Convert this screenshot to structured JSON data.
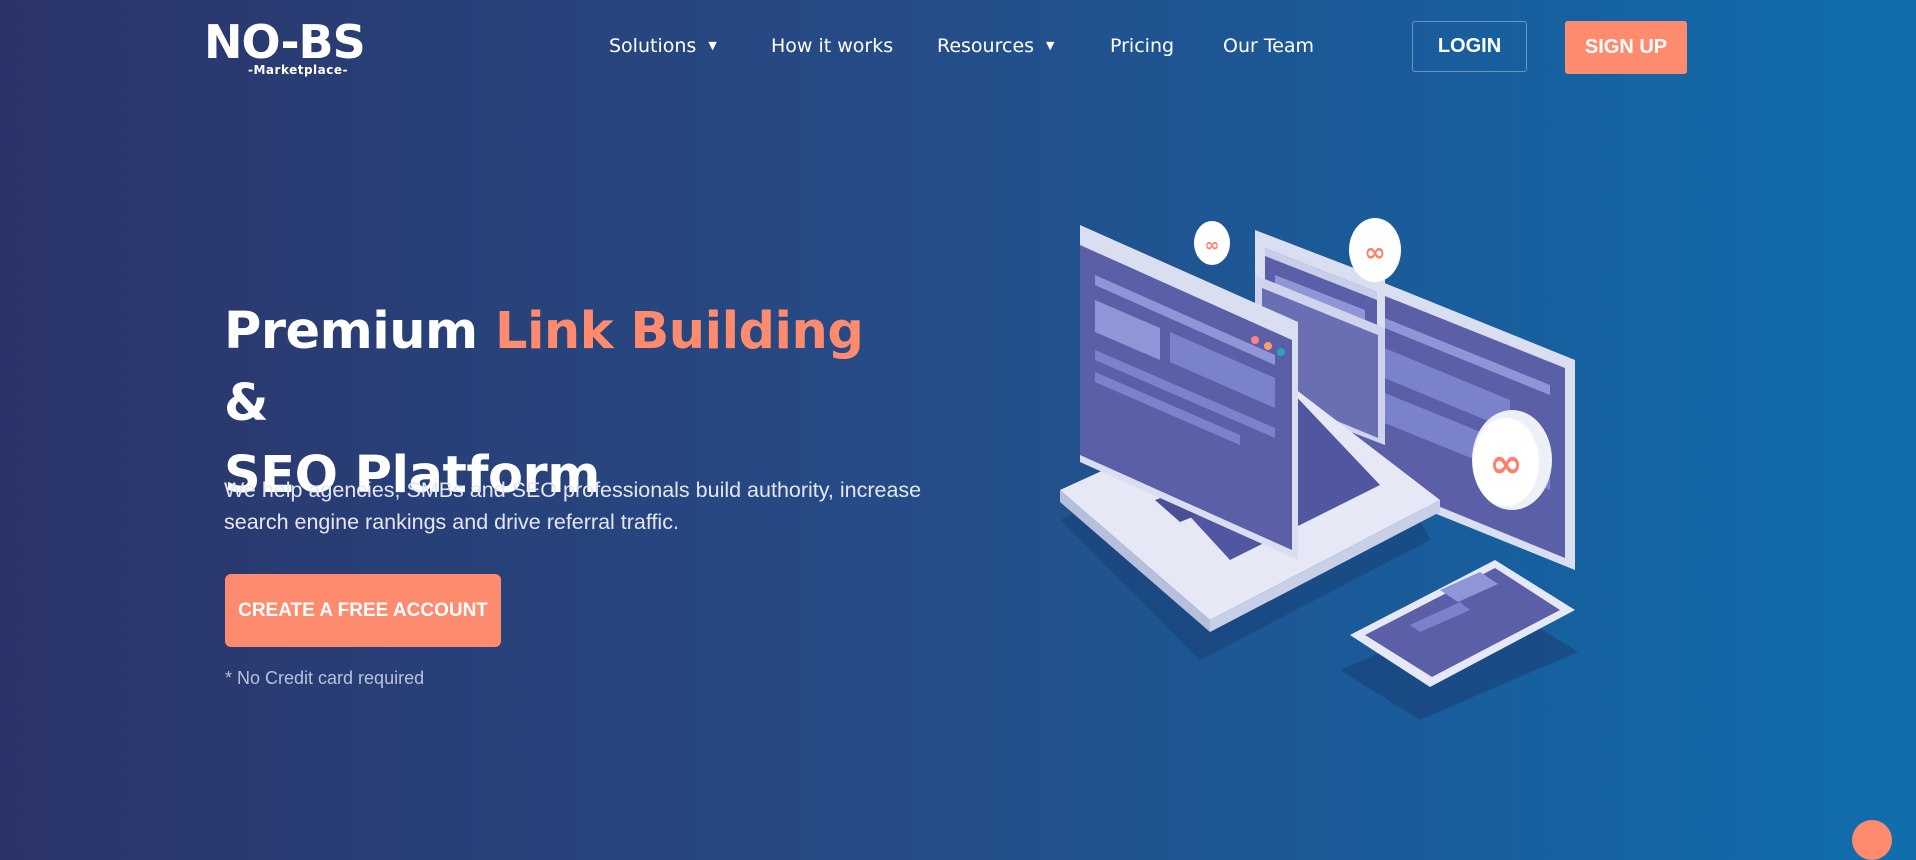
{
  "brand": {
    "logo_text": "NO-BS",
    "logo_sub": "-Marketplace-"
  },
  "nav": {
    "items": [
      {
        "label": "Solutions",
        "has_dropdown": true
      },
      {
        "label": "How it works",
        "has_dropdown": false
      },
      {
        "label": "Resources",
        "has_dropdown": true
      },
      {
        "label": "Pricing",
        "has_dropdown": false
      },
      {
        "label": "Our Team",
        "has_dropdown": false
      }
    ],
    "login_label": "LOGIN",
    "signup_label": "SIGN UP"
  },
  "hero": {
    "title_part1": "Premium ",
    "title_highlight": "Link Building",
    "title_part2": " &",
    "title_line2": "SEO Platform",
    "description": "We help agencies, SMBs and SEO professionals build authority, increase search engine rankings and drive referral traffic.",
    "cta_label": "CREATE A FREE ACCOUNT",
    "note": "* No Credit card required"
  },
  "colors": {
    "accent": "#ff8b6e",
    "bg_start": "#2b3469",
    "bg_end": "#116ead"
  },
  "icons": {
    "dropdown": "caret-down-icon",
    "link": "chain-link-icon"
  }
}
